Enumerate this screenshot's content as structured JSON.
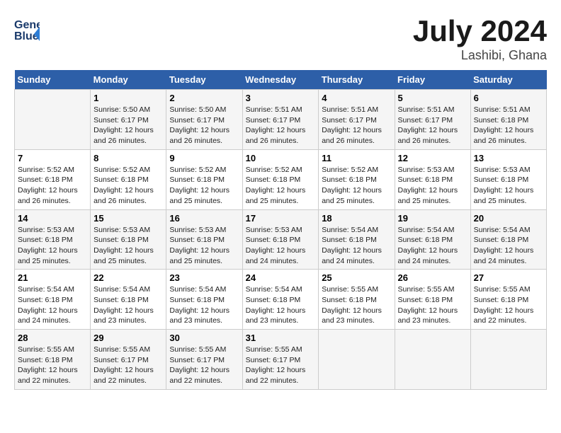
{
  "logo": {
    "line1": "General",
    "line2": "Blue"
  },
  "title": "July 2024",
  "subtitle": "Lashibi, Ghana",
  "header": {
    "days": [
      "Sunday",
      "Monday",
      "Tuesday",
      "Wednesday",
      "Thursday",
      "Friday",
      "Saturday"
    ]
  },
  "weeks": [
    [
      {
        "day": "",
        "content": ""
      },
      {
        "day": "1",
        "content": "Sunrise: 5:50 AM\nSunset: 6:17 PM\nDaylight: 12 hours\nand 26 minutes."
      },
      {
        "day": "2",
        "content": "Sunrise: 5:50 AM\nSunset: 6:17 PM\nDaylight: 12 hours\nand 26 minutes."
      },
      {
        "day": "3",
        "content": "Sunrise: 5:51 AM\nSunset: 6:17 PM\nDaylight: 12 hours\nand 26 minutes."
      },
      {
        "day": "4",
        "content": "Sunrise: 5:51 AM\nSunset: 6:17 PM\nDaylight: 12 hours\nand 26 minutes."
      },
      {
        "day": "5",
        "content": "Sunrise: 5:51 AM\nSunset: 6:17 PM\nDaylight: 12 hours\nand 26 minutes."
      },
      {
        "day": "6",
        "content": "Sunrise: 5:51 AM\nSunset: 6:18 PM\nDaylight: 12 hours\nand 26 minutes."
      }
    ],
    [
      {
        "day": "7",
        "content": "Sunrise: 5:52 AM\nSunset: 6:18 PM\nDaylight: 12 hours\nand 26 minutes."
      },
      {
        "day": "8",
        "content": "Sunrise: 5:52 AM\nSunset: 6:18 PM\nDaylight: 12 hours\nand 26 minutes."
      },
      {
        "day": "9",
        "content": "Sunrise: 5:52 AM\nSunset: 6:18 PM\nDaylight: 12 hours\nand 25 minutes."
      },
      {
        "day": "10",
        "content": "Sunrise: 5:52 AM\nSunset: 6:18 PM\nDaylight: 12 hours\nand 25 minutes."
      },
      {
        "day": "11",
        "content": "Sunrise: 5:52 AM\nSunset: 6:18 PM\nDaylight: 12 hours\nand 25 minutes."
      },
      {
        "day": "12",
        "content": "Sunrise: 5:53 AM\nSunset: 6:18 PM\nDaylight: 12 hours\nand 25 minutes."
      },
      {
        "day": "13",
        "content": "Sunrise: 5:53 AM\nSunset: 6:18 PM\nDaylight: 12 hours\nand 25 minutes."
      }
    ],
    [
      {
        "day": "14",
        "content": "Sunrise: 5:53 AM\nSunset: 6:18 PM\nDaylight: 12 hours\nand 25 minutes."
      },
      {
        "day": "15",
        "content": "Sunrise: 5:53 AM\nSunset: 6:18 PM\nDaylight: 12 hours\nand 25 minutes."
      },
      {
        "day": "16",
        "content": "Sunrise: 5:53 AM\nSunset: 6:18 PM\nDaylight: 12 hours\nand 25 minutes."
      },
      {
        "day": "17",
        "content": "Sunrise: 5:53 AM\nSunset: 6:18 PM\nDaylight: 12 hours\nand 24 minutes."
      },
      {
        "day": "18",
        "content": "Sunrise: 5:54 AM\nSunset: 6:18 PM\nDaylight: 12 hours\nand 24 minutes."
      },
      {
        "day": "19",
        "content": "Sunrise: 5:54 AM\nSunset: 6:18 PM\nDaylight: 12 hours\nand 24 minutes."
      },
      {
        "day": "20",
        "content": "Sunrise: 5:54 AM\nSunset: 6:18 PM\nDaylight: 12 hours\nand 24 minutes."
      }
    ],
    [
      {
        "day": "21",
        "content": "Sunrise: 5:54 AM\nSunset: 6:18 PM\nDaylight: 12 hours\nand 24 minutes."
      },
      {
        "day": "22",
        "content": "Sunrise: 5:54 AM\nSunset: 6:18 PM\nDaylight: 12 hours\nand 23 minutes."
      },
      {
        "day": "23",
        "content": "Sunrise: 5:54 AM\nSunset: 6:18 PM\nDaylight: 12 hours\nand 23 minutes."
      },
      {
        "day": "24",
        "content": "Sunrise: 5:54 AM\nSunset: 6:18 PM\nDaylight: 12 hours\nand 23 minutes."
      },
      {
        "day": "25",
        "content": "Sunrise: 5:55 AM\nSunset: 6:18 PM\nDaylight: 12 hours\nand 23 minutes."
      },
      {
        "day": "26",
        "content": "Sunrise: 5:55 AM\nSunset: 6:18 PM\nDaylight: 12 hours\nand 23 minutes."
      },
      {
        "day": "27",
        "content": "Sunrise: 5:55 AM\nSunset: 6:18 PM\nDaylight: 12 hours\nand 22 minutes."
      }
    ],
    [
      {
        "day": "28",
        "content": "Sunrise: 5:55 AM\nSunset: 6:18 PM\nDaylight: 12 hours\nand 22 minutes."
      },
      {
        "day": "29",
        "content": "Sunrise: 5:55 AM\nSunset: 6:17 PM\nDaylight: 12 hours\nand 22 minutes."
      },
      {
        "day": "30",
        "content": "Sunrise: 5:55 AM\nSunset: 6:17 PM\nDaylight: 12 hours\nand 22 minutes."
      },
      {
        "day": "31",
        "content": "Sunrise: 5:55 AM\nSunset: 6:17 PM\nDaylight: 12 hours\nand 22 minutes."
      },
      {
        "day": "",
        "content": ""
      },
      {
        "day": "",
        "content": ""
      },
      {
        "day": "",
        "content": ""
      }
    ]
  ]
}
